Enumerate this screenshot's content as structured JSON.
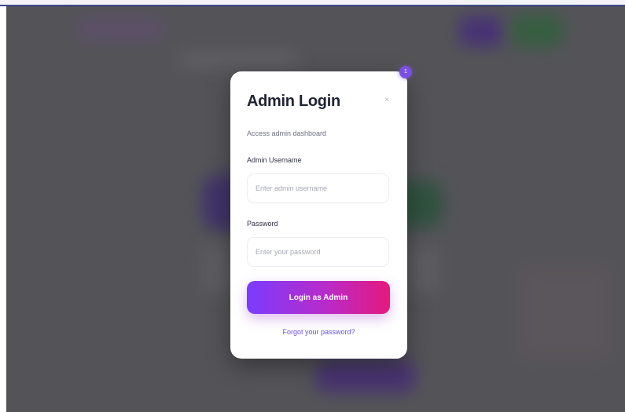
{
  "modal": {
    "title": "Admin Login",
    "subtitle": "Access admin dashboard",
    "badge_count": "1",
    "close_symbol": "×",
    "username_label": "Admin Username",
    "username_placeholder": "Enter admin username",
    "username_value": "",
    "password_label": "Password",
    "password_placeholder": "Enter your password",
    "password_value": "",
    "login_button_label": "Login as Admin",
    "forgot_link_label": "Forgot your password?"
  },
  "colors": {
    "accent_start": "#7a3cff",
    "accent_end": "#e5197d",
    "link": "#6a4fe0",
    "badge": "#7b4fe0",
    "title": "#1f2333"
  },
  "icons": {
    "close": "close-icon",
    "badge": "notification-badge"
  }
}
